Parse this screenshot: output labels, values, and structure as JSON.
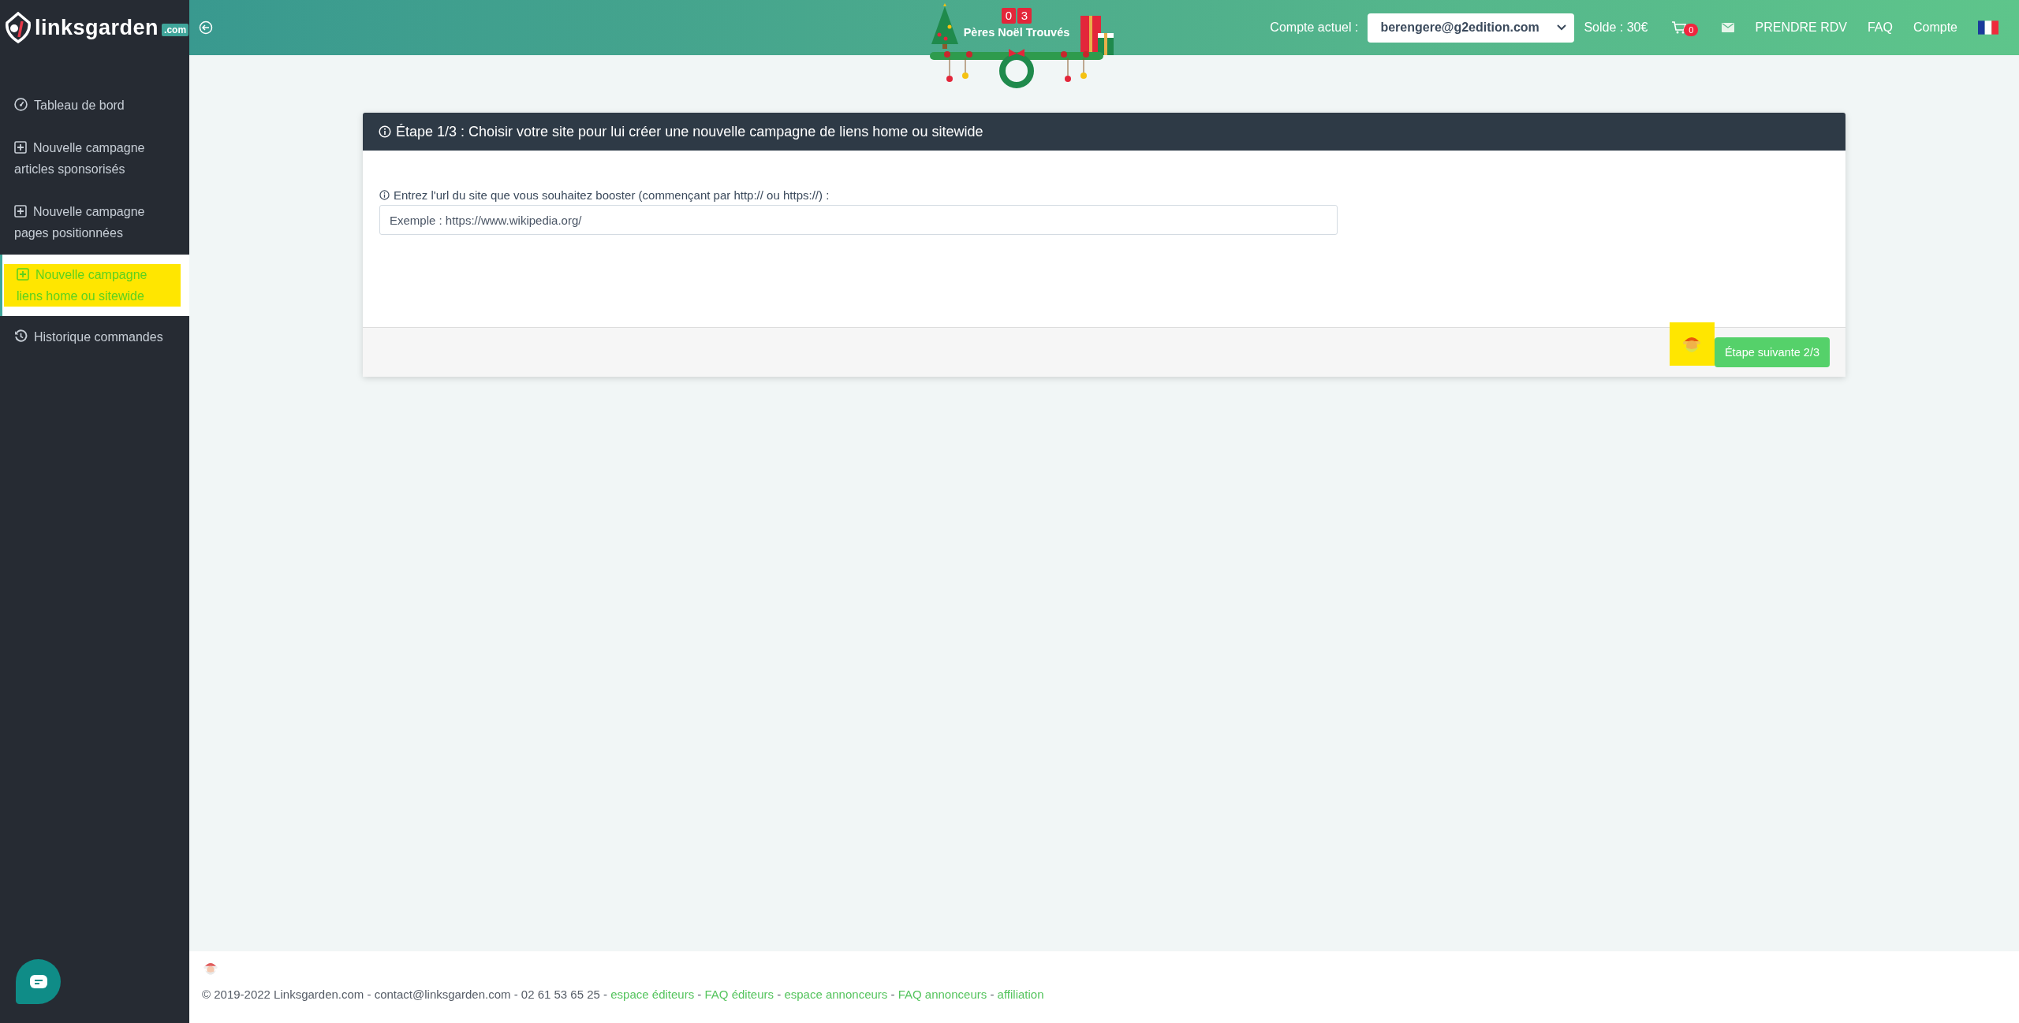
{
  "sidebar": {
    "logo": {
      "name": "linksgarden",
      "tld": ".com"
    },
    "items": [
      {
        "label": "Tableau de bord",
        "kind": "gauge",
        "selected": false
      },
      {
        "label": "Nouvelle campagne articles sponsorisés",
        "kind": "plus",
        "selected": false
      },
      {
        "label": "Nouvelle campagne pages positionnées",
        "kind": "plus",
        "selected": false
      },
      {
        "label": "Nouvelle campagne liens home ou sitewide",
        "kind": "plus",
        "selected": true
      },
      {
        "label": "Historique commandes",
        "kind": "history",
        "selected": false
      }
    ]
  },
  "topbar": {
    "account_label": "Compte actuel :",
    "account": "berengere@g2edition.com",
    "balance": "Solde : 30€",
    "cart_count": "0",
    "links": [
      "PRENDRE RDV",
      "FAQ",
      "Compte"
    ]
  },
  "banner": {
    "counter": [
      "0",
      "3"
    ],
    "title": "Pères Noël Trouvés"
  },
  "card": {
    "title": "Étape 1/3 : Choisir votre site pour lui créer une nouvelle campagne de liens home ou sitewide",
    "field_label": "Entrez l'url du site que vous souhaitez booster (commençant par http:// ou https://) :",
    "placeholder": "Exemple : https://www.wikipedia.org/",
    "next_button": "Étape suivante 2/3"
  },
  "footer": {
    "text": "© 2019-2022 Linksgarden.com - contact@linksgarden.com - 02 61 53 65 25 -",
    "separator": "-",
    "links": [
      "espace éditeurs",
      "FAQ éditeurs",
      "espace annonceurs",
      "FAQ annonceurs",
      "affiliation"
    ]
  }
}
